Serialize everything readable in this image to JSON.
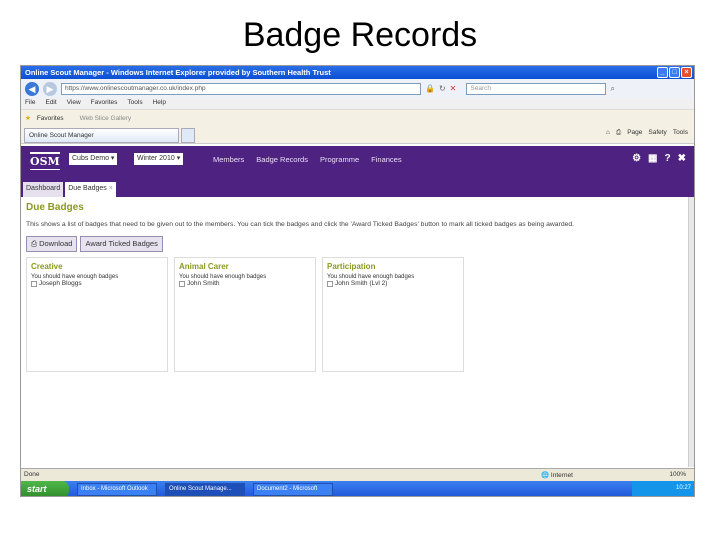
{
  "slide": {
    "title": "Badge Records"
  },
  "browser": {
    "title": "Online Scout Manager - Windows Internet Explorer provided by Southern Health Trust",
    "url": "https://www.onlinescoutmanager.co.uk/index.php",
    "search_placeholder": "Search",
    "menu": [
      "File",
      "Edit",
      "View",
      "Favorites",
      "Tools",
      "Help"
    ],
    "favorites_label": "Favorites",
    "web_slice": "Web Slice Gallery",
    "tab_label": "Online Scout Manager",
    "commands": [
      "Page",
      "Safety",
      "Tools"
    ],
    "status": "Done",
    "zone": "Internet",
    "zoom": "100%"
  },
  "osm": {
    "logo": "OSM",
    "section_select": "Cubs Demo",
    "term_select": "Winter 2010",
    "nav": [
      "Members",
      "Badge Records",
      "Programme",
      "Finances"
    ],
    "subtabs": [
      "Dashboard",
      "Due Badges"
    ],
    "page_title": "Due Badges",
    "description": "This shows a list of badges that need to be given out to the members. You can tick the badges and click the 'Award Ticked Badges' button to mark all ticked badges as being awarded.",
    "buttons": {
      "download": "Download",
      "award": "Award Ticked Badges"
    },
    "cards": [
      {
        "title": "Creative",
        "note": "You should have enough badges",
        "member": "Joseph Bloggs"
      },
      {
        "title": "Animal Carer",
        "note": "You should have enough badges",
        "member": "John Smith"
      },
      {
        "title": "Participation",
        "note": "You should have enough badges",
        "member": "John Smith (Lvl 2)"
      }
    ]
  },
  "taskbar": {
    "start": "start",
    "tasks": [
      "Inbox - Microsoft Outlook",
      "Online Scout Manage...",
      "Document2 - Microsoft"
    ],
    "clock": "10:27"
  }
}
